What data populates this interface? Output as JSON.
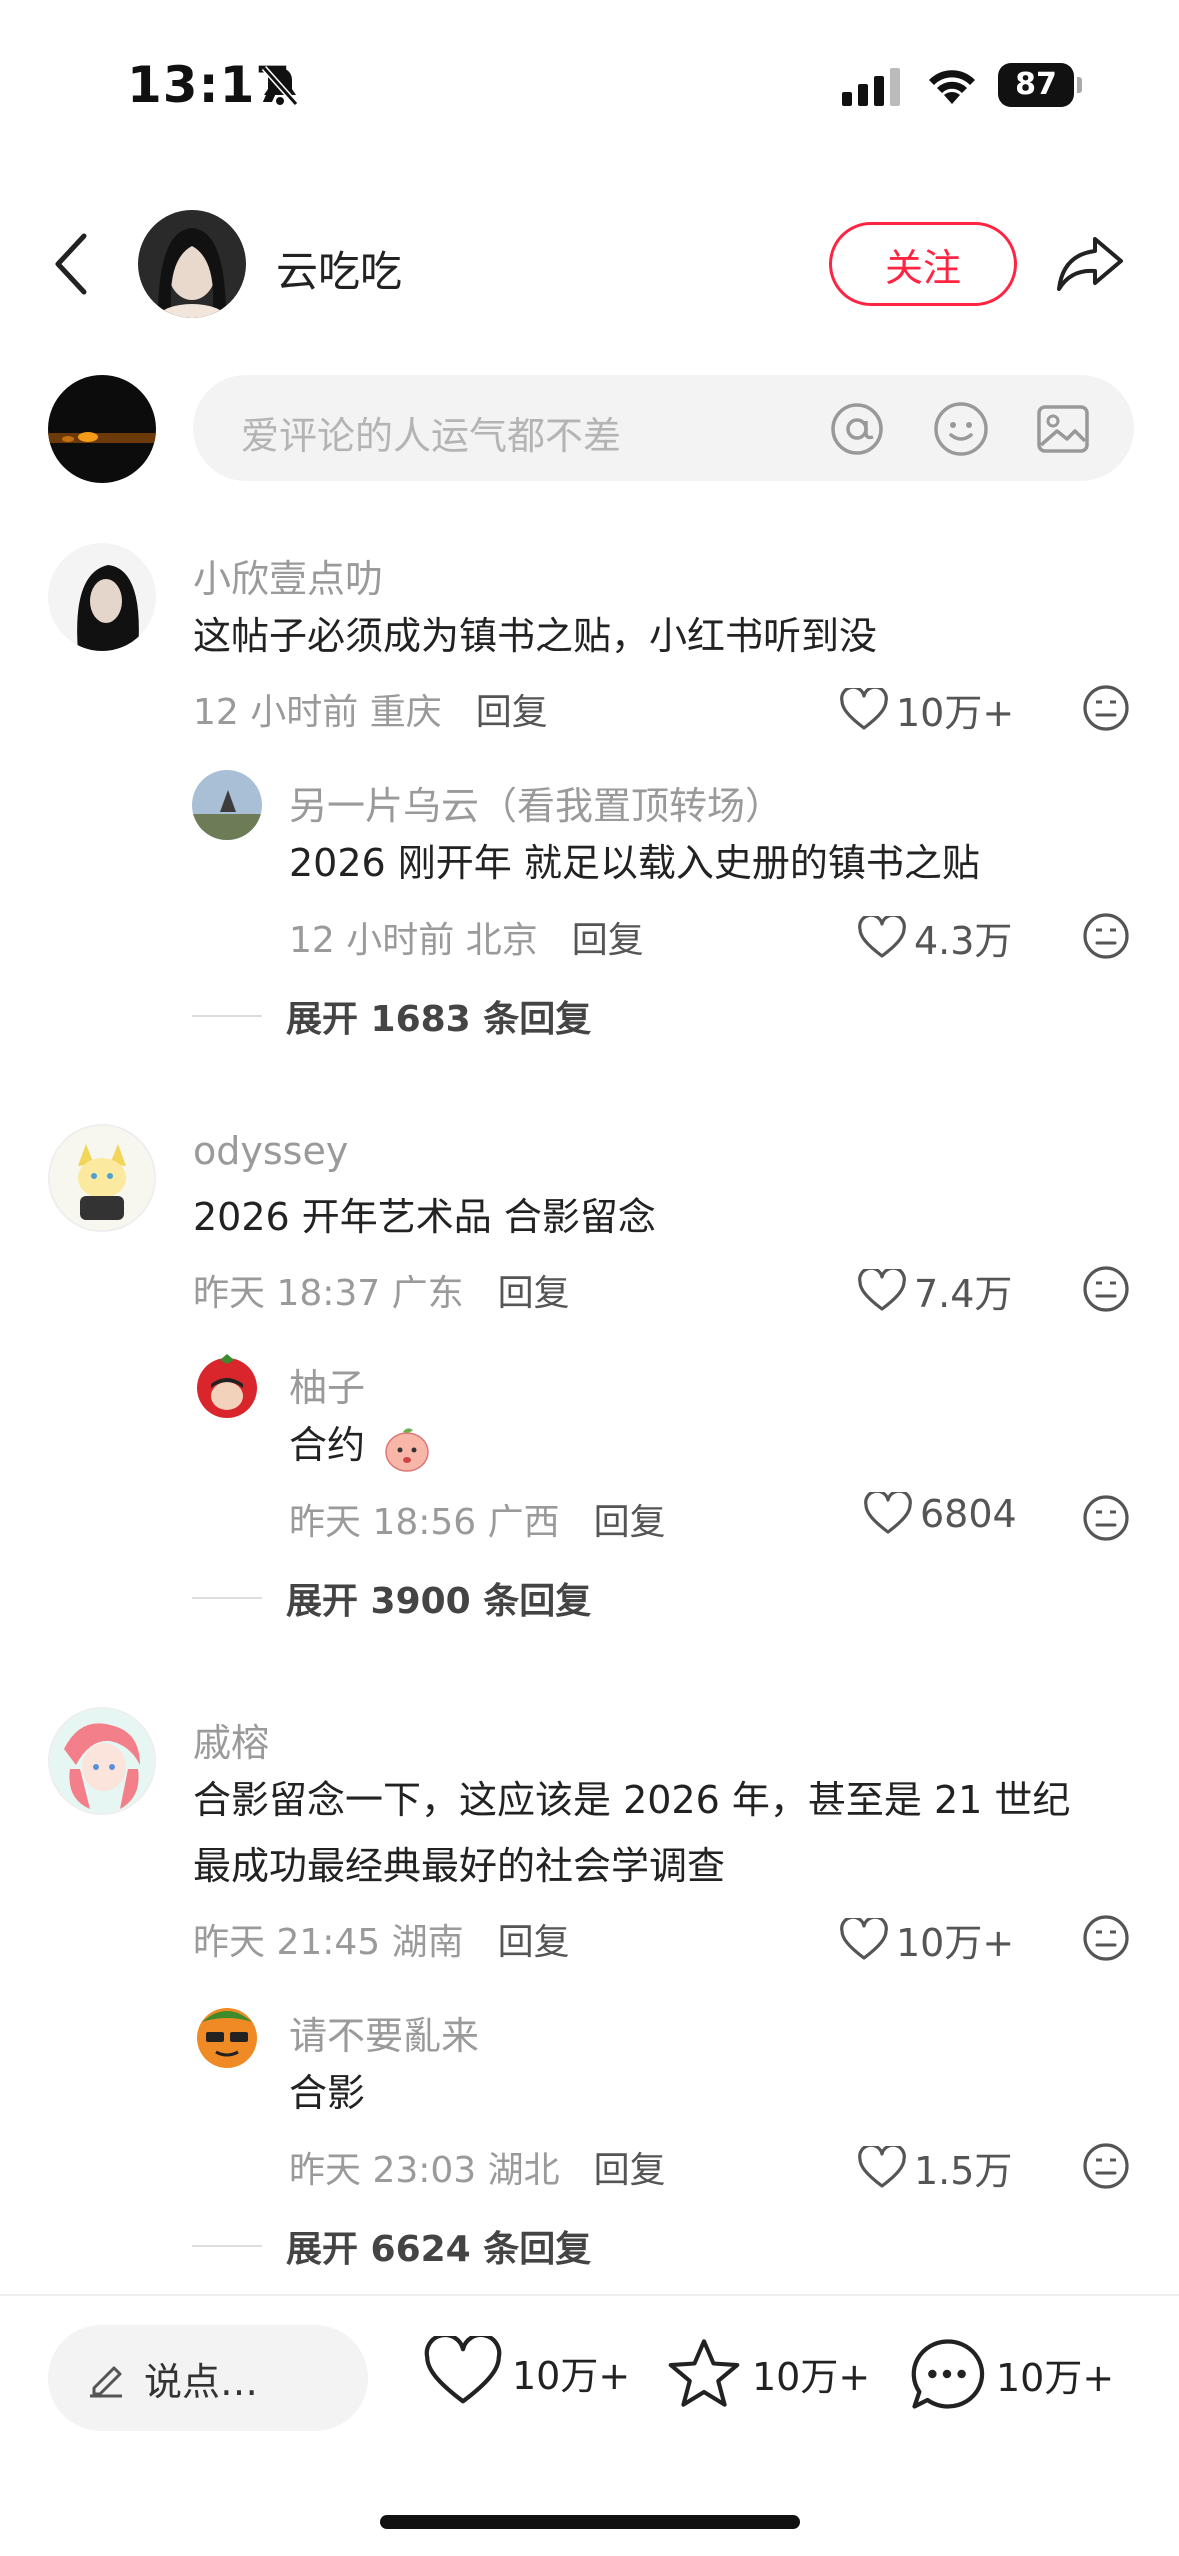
{
  "status": {
    "time": "13:17",
    "battery": "87"
  },
  "header": {
    "author_name": "云吃吃",
    "follow_label": "关注"
  },
  "comment_input": {
    "placeholder": "爱评论的人运气都不差"
  },
  "comments": [
    {
      "name": "小欣壹点叻",
      "text": "这帖子必须成为镇书之贴，小红书听到没",
      "time_loc": "12 小时前 重庆",
      "reply": "回复",
      "likes": "10万+",
      "sub": {
        "name": "另一片乌云（看我置顶转场）",
        "text": "2026 刚开年 就足以载入史册的镇书之贴",
        "time_loc": "12 小时前 北京",
        "reply": "回复",
        "likes": "4.3万"
      },
      "expand": "展开 1683 条回复"
    },
    {
      "name": "odyssey",
      "text": "2026 开年艺术品 合影留念",
      "time_loc": "昨天 18:37 广东",
      "reply": "回复",
      "likes": "7.4万",
      "sub": {
        "name": "柚子",
        "text": "合约",
        "time_loc": "昨天 18:56 广西",
        "reply": "回复",
        "likes": "6804"
      },
      "expand": "展开 3900 条回复"
    },
    {
      "name": "戚榕",
      "text_line1": "合影留念一下，这应该是 2026 年，甚至是 21 世纪",
      "text_line2": "最成功最经典最好的社会学调查",
      "time_loc": "昨天 21:45 湖南",
      "reply": "回复",
      "likes": "10万+",
      "sub": {
        "name": "请不要亂来",
        "text": "合影",
        "time_loc": "昨天 23:03 湖北",
        "reply": "回复",
        "likes": "1.5万"
      },
      "expand": "展开 6624 条回复"
    }
  ],
  "bottom_bar": {
    "say_placeholder": "说点…",
    "likes": "10万+",
    "collects": "10万+",
    "comments": "10万+"
  },
  "colors": {
    "accent": "#ff2442",
    "muted": "#9a9a9a",
    "input_bg": "#f3f3f3"
  }
}
